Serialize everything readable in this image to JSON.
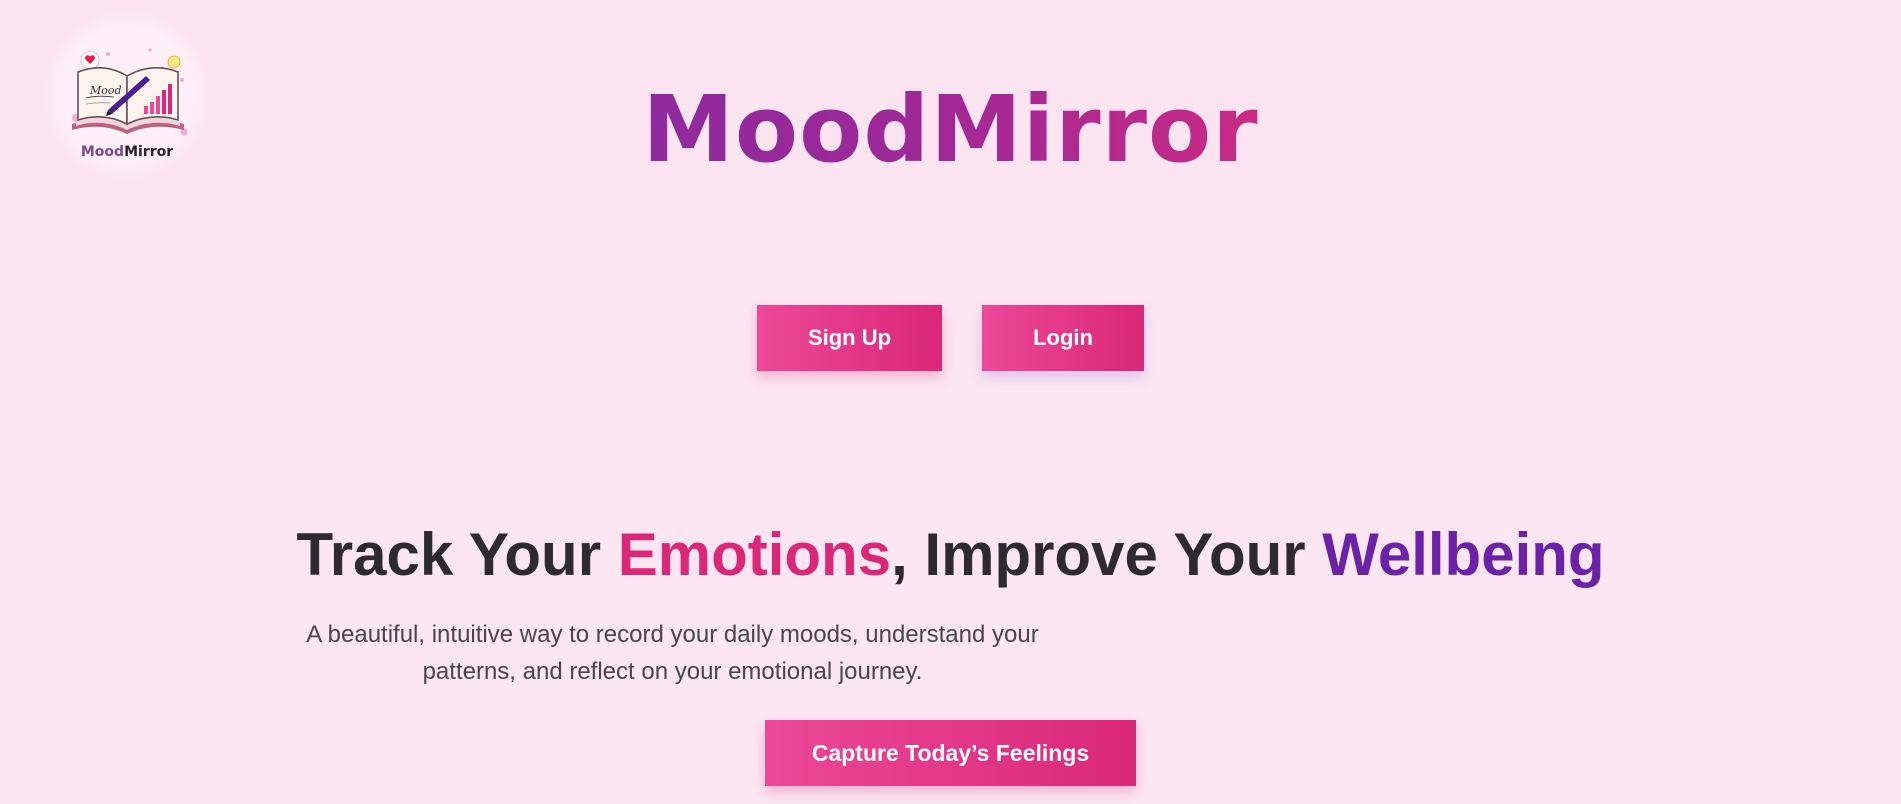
{
  "logo": {
    "text_mood": "Mood",
    "text_mirror": "Mirror",
    "book_text": "Mood",
    "icon": "journal-book-icon"
  },
  "brand": {
    "title": "MoodMirror"
  },
  "auth": {
    "signup_label": "Sign Up",
    "login_label": "Login"
  },
  "hero": {
    "headline_part1": "Track Your ",
    "headline_highlight1": "Emotions",
    "headline_part2": ", Improve Your ",
    "headline_highlight2": "Wellbeing",
    "tagline": "A beautiful, intuitive way to record your daily moods, understand your patterns, and reflect on your emotional journey.",
    "cta_label": "Capture Today’s Feelings"
  },
  "colors": {
    "accent_pink": "#db2777",
    "accent_purple": "#6b21a8",
    "background": "#fde4f0"
  }
}
